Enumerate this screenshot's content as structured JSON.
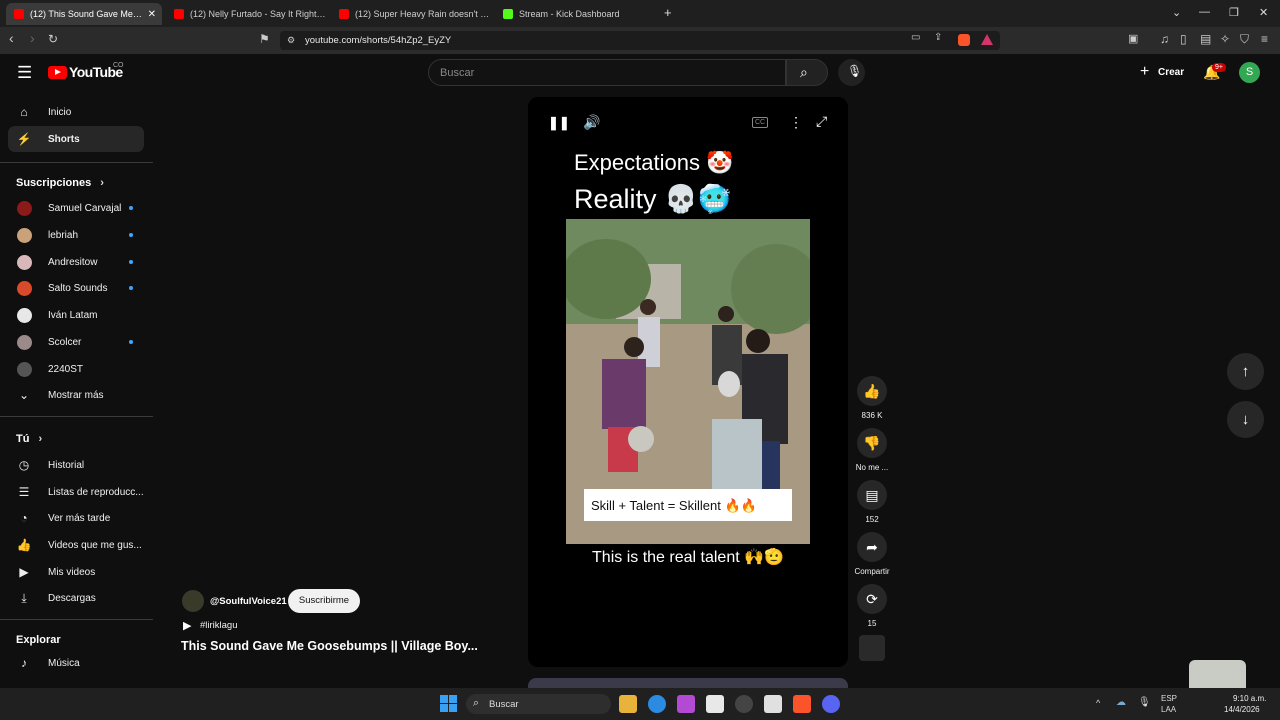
{
  "browser": {
    "tabs": [
      {
        "title": "(12) This Sound Gave Me Goosebumps || Village Boy...",
        "active": true
      },
      {
        "title": "(12) Nelly Furtado - Say It Right (Official Music Video)",
        "active": false
      },
      {
        "title": "(12) Super Heavy Rain doesn't stop at night",
        "active": false
      },
      {
        "title": "Stream - Kick Dashboard",
        "active": false
      }
    ],
    "url": "youtube.com/shorts/54hZp2_EyZY"
  },
  "header": {
    "logo": "YouTube",
    "country": "CO",
    "search_placeholder": "Buscar",
    "create_label": "Crear",
    "notif_count": "9+",
    "avatar_letter": "S"
  },
  "sidebar": {
    "main": [
      {
        "label": "Inicio",
        "icon": "home-icon"
      },
      {
        "label": "Shorts",
        "icon": "shorts-icon",
        "selected": true
      }
    ],
    "subs_title": "Suscripciones",
    "subscriptions": [
      {
        "label": "Samuel Carvajal",
        "color": "#8b1a1a",
        "dot": true
      },
      {
        "label": "lebriah",
        "color": "#c9a27a",
        "dot": true
      },
      {
        "label": "Andresitow",
        "color": "#d8b8b8",
        "dot": true
      },
      {
        "label": "Salto Sounds",
        "color": "#d94a2a",
        "dot": true
      },
      {
        "label": "Iván Latam",
        "color": "#e8e8e8",
        "dot": false
      },
      {
        "label": "Scolcer",
        "color": "#9a8a8a",
        "dot": true
      },
      {
        "label": "2240ST",
        "color": "#555555",
        "dot": false
      }
    ],
    "show_more": "Mostrar más",
    "you_title": "Tú",
    "you_items": [
      {
        "label": "Historial",
        "icon": "history-icon"
      },
      {
        "label": "Listas de reproducc...",
        "icon": "playlists-icon"
      },
      {
        "label": "Ver más tarde",
        "icon": "watch-later-icon"
      },
      {
        "label": "Videos que me gus...",
        "icon": "liked-icon"
      },
      {
        "label": "Mis videos",
        "icon": "my-videos-icon"
      },
      {
        "label": "Descargas",
        "icon": "downloads-icon"
      }
    ],
    "explore_title": "Explorar",
    "explore_items": [
      {
        "label": "Música",
        "icon": "music-icon"
      }
    ]
  },
  "player": {
    "overlay_line1": "Expectations 🤡",
    "overlay_line2": "Reality 💀🥶",
    "caption": "Skill + Talent = Skillent 🔥🔥",
    "subtitle": "This is the real talent 🙌🫡"
  },
  "actions": {
    "likes": "836 K",
    "dislike": "No me ...",
    "comments": "152",
    "share": "Compartir",
    "remix": "15"
  },
  "channel": {
    "handle": "@SoulfulVoice21",
    "subscribe": "Suscribirme",
    "hashtag": "#liriklagu",
    "title": "This Sound Gave Me Goosebumps || Village Boy..."
  },
  "taskbar": {
    "search": "Buscar",
    "lang1": "ESP",
    "lang2": "LAA",
    "time": "9:10 a.m.",
    "date": "14/4/2026"
  }
}
